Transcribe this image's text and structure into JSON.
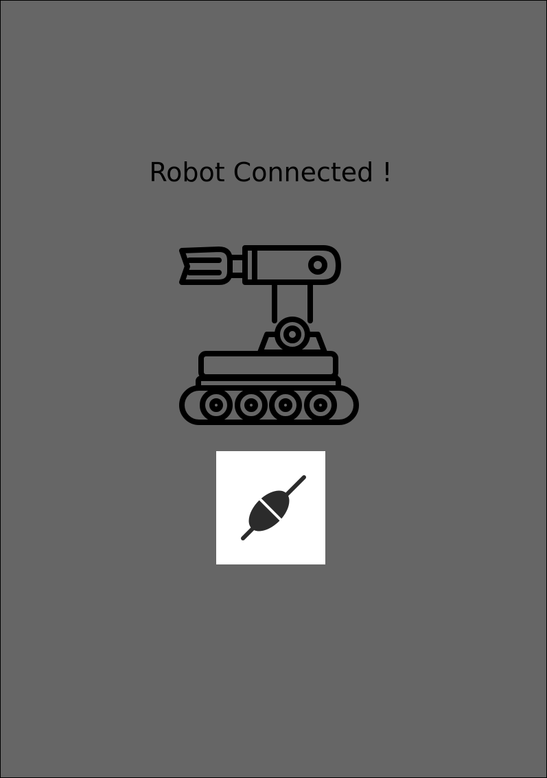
{
  "status": {
    "message": "Robot Connected !"
  },
  "illustration": {
    "icon": "robot-tank-arm-icon"
  },
  "connect_button": {
    "icon": "plug-connected-icon"
  },
  "colors": {
    "background": "#666666",
    "border": "#000000",
    "text": "#000000",
    "button_background": "#ffffff",
    "plug_icon": "#2b2b2b"
  }
}
